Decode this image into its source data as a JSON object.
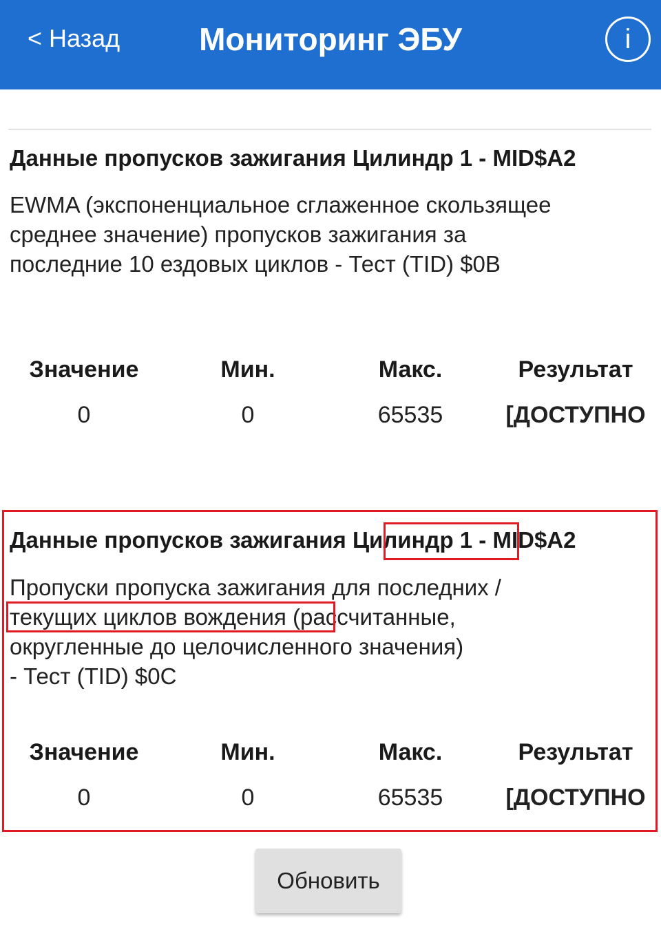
{
  "header": {
    "back_label": "< Назад",
    "title": "Мониторинг ЭБУ",
    "info_label": "i",
    "background_color": "#1e6fd0"
  },
  "tests": [
    {
      "title": "Данные пропусков зажигания Цилиндр 1 - MID$A2",
      "description_lines": [
        "EWMA (экспоненциальное сглаженное скользящее",
        "среднее значение) пропусков зажигания за",
        "последние 10 ездовых циклов - Тест (TID) $0B"
      ],
      "columns": {
        "value": {
          "label": "Значение",
          "value": "0"
        },
        "min": {
          "label": "Мин.",
          "value": "0"
        },
        "max": {
          "label": "Макс.",
          "value": "65535"
        },
        "result": {
          "label": "Результат",
          "value": "[ДОСТУПНО"
        }
      }
    },
    {
      "title_parts": [
        "Данные пропусков зажигания ",
        "Цилиндр 1",
        " - MID$A2"
      ],
      "description_lines": [
        "Пропуски пропуска зажигания для последних /",
        "текущих циклов вождения",
        " (рассчитанные,",
        "округленные до целочисленного значения)",
        "- Тест (TID) $0C"
      ],
      "columns": {
        "value": {
          "label": "Значение",
          "value": "0"
        },
        "min": {
          "label": "Мин.",
          "value": "0"
        },
        "max": {
          "label": "Макс.",
          "value": "65535"
        },
        "result": {
          "label": "Результат",
          "value": "[ДОСТУПНО"
        }
      }
    }
  ],
  "highlight_color": "#e01b24",
  "refresh_label": "Обновить"
}
